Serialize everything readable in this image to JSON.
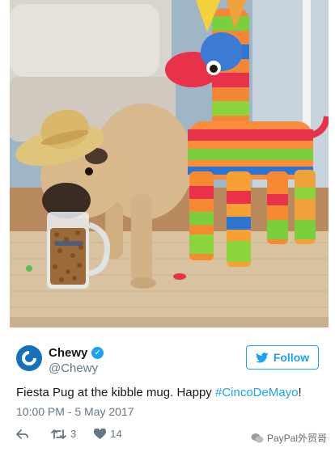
{
  "photo": {
    "description_icon": "photo-pug-pinata"
  },
  "account": {
    "display_name": "Chewy",
    "handle": "@Chewy",
    "verified": true,
    "avatar_color": "#1670bb"
  },
  "follow_button": {
    "label": "Follow",
    "color": "#1da1f2"
  },
  "tweet": {
    "text_before": "Fiesta Pug at the kibble mug. Happy ",
    "hashtag": "#CincoDeMayo",
    "text_after": "!",
    "timestamp": "10:00 PM - 5 May 2017"
  },
  "actions": {
    "retweet_count": "3",
    "like_count": "14"
  },
  "watermark": {
    "text": "PayPal外贸哥"
  }
}
